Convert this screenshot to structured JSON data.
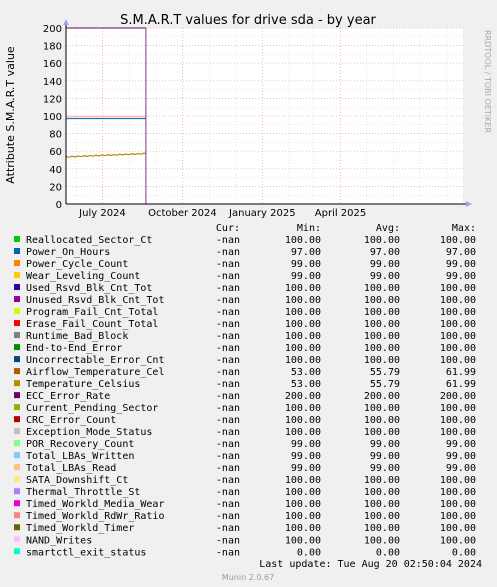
{
  "colors": {
    "background": "#f0f0f0",
    "plot_background": "#ffffff",
    "grid_minor": "#e8c8c8",
    "grid_major": "#e6a0a0",
    "axis": "#000000"
  },
  "watermark": "RRDTOOL / TOBI OETIKER",
  "last_update": "Last update: Tue Aug 20 02:50:04 2024",
  "footer": "Munin 2.0.67",
  "chart_data": {
    "type": "line",
    "title": "S.M.A.R.T values for drive sda - by year",
    "ylabel": "Attribute S.M.A.R.T value",
    "ylim": [
      0,
      200
    ],
    "y_ticks": [
      0,
      20,
      40,
      60,
      80,
      100,
      120,
      140,
      160,
      180,
      200
    ],
    "x_range": [
      "2024-05-20",
      "2025-08-20"
    ],
    "x_ticks": [
      {
        "date": "2024-07-01",
        "label": "July 2024"
      },
      {
        "date": "2024-10-01",
        "label": "October 2024"
      },
      {
        "date": "2025-01-01",
        "label": "January 2025"
      },
      {
        "date": "2025-04-01",
        "label": "April 2025"
      }
    ],
    "x_month_gridlines": [
      "2024-06-01",
      "2024-07-01",
      "2024-08-01",
      "2024-09-01",
      "2024-10-01",
      "2024-11-01",
      "2024-12-01",
      "2025-01-01",
      "2025-02-01",
      "2025-03-01",
      "2025-04-01",
      "2025-05-01",
      "2025-06-01",
      "2025-07-01",
      "2025-08-01"
    ],
    "data_start": "2024-05-20",
    "data_end": "2024-08-20",
    "grid": true,
    "legend_header": {
      "cur": "Cur:",
      "min": "Min:",
      "avg": "Avg:",
      "max": "Max:"
    },
    "series": [
      {
        "name": "Reallocated_Sector_Ct",
        "color": "#00cc00",
        "cur": "-nan",
        "min": "100.00",
        "avg": "100.00",
        "max": "100.00",
        "value": 100
      },
      {
        "name": "Power_On_Hours",
        "color": "#0066b3",
        "cur": "-nan",
        "min": "97.00",
        "avg": "97.00",
        "max": "97.00",
        "value": 97
      },
      {
        "name": "Power_Cycle_Count",
        "color": "#ff8000",
        "cur": "-nan",
        "min": "99.00",
        "avg": "99.00",
        "max": "99.00",
        "value": 99
      },
      {
        "name": "Wear_Leveling_Count",
        "color": "#ffcc00",
        "cur": "-nan",
        "min": "99.00",
        "avg": "99.00",
        "max": "99.00",
        "value": 99
      },
      {
        "name": "Used_Rsvd_Blk_Cnt_Tot",
        "color": "#330099",
        "cur": "-nan",
        "min": "100.00",
        "avg": "100.00",
        "max": "100.00",
        "value": 100
      },
      {
        "name": "Unused_Rsvd_Blk_Cnt_Tot",
        "color": "#990099",
        "cur": "-nan",
        "min": "100.00",
        "avg": "100.00",
        "max": "100.00",
        "value": 100
      },
      {
        "name": "Program_Fail_Cnt_Total",
        "color": "#ccff00",
        "cur": "-nan",
        "min": "100.00",
        "avg": "100.00",
        "max": "100.00",
        "value": 100
      },
      {
        "name": "Erase_Fail_Count_Total",
        "color": "#ff0000",
        "cur": "-nan",
        "min": "100.00",
        "avg": "100.00",
        "max": "100.00",
        "value": 100
      },
      {
        "name": "Runtime_Bad_Block",
        "color": "#808080",
        "cur": "-nan",
        "min": "100.00",
        "avg": "100.00",
        "max": "100.00",
        "value": 100
      },
      {
        "name": "End-to-End_Error",
        "color": "#008f00",
        "cur": "-nan",
        "min": "100.00",
        "avg": "100.00",
        "max": "100.00",
        "value": 100
      },
      {
        "name": "Uncorrectable_Error_Cnt",
        "color": "#00487d",
        "cur": "-nan",
        "min": "100.00",
        "avg": "100.00",
        "max": "100.00",
        "value": 100
      },
      {
        "name": "Airflow_Temperature_Cel",
        "color": "#b35a00",
        "cur": "-nan",
        "min": "53.00",
        "avg": "55.79",
        "max": "61.99",
        "value": 56
      },
      {
        "name": "Temperature_Celsius",
        "color": "#b38f00",
        "cur": "-nan",
        "min": "53.00",
        "avg": "55.79",
        "max": "61.99",
        "value": 56
      },
      {
        "name": "ECC_Error_Rate",
        "color": "#6b006b",
        "cur": "-nan",
        "min": "200.00",
        "avg": "200.00",
        "max": "200.00",
        "value": 200
      },
      {
        "name": "Current_Pending_Sector",
        "color": "#8fb300",
        "cur": "-nan",
        "min": "100.00",
        "avg": "100.00",
        "max": "100.00",
        "value": 100
      },
      {
        "name": "CRC_Error_Count",
        "color": "#b30000",
        "cur": "-nan",
        "min": "100.00",
        "avg": "100.00",
        "max": "100.00",
        "value": 100
      },
      {
        "name": "Exception_Mode_Status",
        "color": "#bebebe",
        "cur": "-nan",
        "min": "100.00",
        "avg": "100.00",
        "max": "100.00",
        "value": 100
      },
      {
        "name": "POR_Recovery_Count",
        "color": "#80ff80",
        "cur": "-nan",
        "min": "99.00",
        "avg": "99.00",
        "max": "99.00",
        "value": 99
      },
      {
        "name": "Total_LBAs_Written",
        "color": "#80c9ff",
        "cur": "-nan",
        "min": "99.00",
        "avg": "99.00",
        "max": "99.00",
        "value": 99
      },
      {
        "name": "Total_LBAs_Read",
        "color": "#ffc080",
        "cur": "-nan",
        "min": "99.00",
        "avg": "99.00",
        "max": "99.00",
        "value": 99
      },
      {
        "name": "SATA_Downshift_Ct",
        "color": "#ffe680",
        "cur": "-nan",
        "min": "100.00",
        "avg": "100.00",
        "max": "100.00",
        "value": 100
      },
      {
        "name": "Thermal_Throttle_St",
        "color": "#aa80ff",
        "cur": "-nan",
        "min": "100.00",
        "avg": "100.00",
        "max": "100.00",
        "value": 100
      },
      {
        "name": "Timed_Workld_Media_Wear",
        "color": "#ee00cc",
        "cur": "-nan",
        "min": "100.00",
        "avg": "100.00",
        "max": "100.00",
        "value": 100
      },
      {
        "name": "Timed_Workld_RdWr_Ratio",
        "color": "#ff8080",
        "cur": "-nan",
        "min": "100.00",
        "avg": "100.00",
        "max": "100.00",
        "value": 100
      },
      {
        "name": "Timed_Workld_Timer",
        "color": "#666600",
        "cur": "-nan",
        "min": "100.00",
        "avg": "100.00",
        "max": "100.00",
        "value": 100
      },
      {
        "name": "NAND_Writes",
        "color": "#ffbfff",
        "cur": "-nan",
        "min": "100.00",
        "avg": "100.00",
        "max": "100.00",
        "value": 100
      },
      {
        "name": "smartctl_exit_status",
        "color": "#00ffcc",
        "cur": "-nan",
        "min": "0.00",
        "avg": "0.00",
        "max": "0.00",
        "value": 0
      }
    ]
  }
}
